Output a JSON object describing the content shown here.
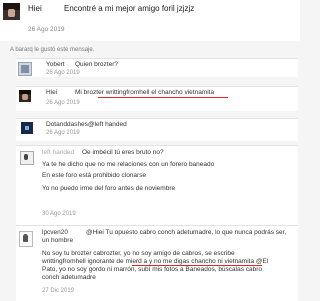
{
  "top_message": {
    "author": "Hiei",
    "text": "Encontré a mi mejor amigo foril jzjzjz",
    "date": "26 Ago 2019"
  },
  "reaction": {
    "text": "A bararq le gustó este mensaje."
  },
  "messages": [
    {
      "author": "Yobert",
      "text": "Quien brozter?",
      "date": "26 Ago 2019",
      "lines": []
    },
    {
      "author": "Hiei",
      "text": "Mi brozter writtingfromhell el chancho vietnamita",
      "date": "26 Ago 2019",
      "lines": []
    },
    {
      "author": "Dotanddashes",
      "text": "@left handed",
      "date": "26 Ago 2019",
      "lines": []
    },
    {
      "author": "left handed",
      "text": "Oe imbécil tú eres bruto no?",
      "date": "30 Ago 2019",
      "lines": [
        "Ya te he dicho que no me relaciones con un forero baneado",
        "En este foro está prohibido clonarse",
        "Yo no puedo irme del foro antes de noviembre"
      ]
    },
    {
      "author": "lpcven20",
      "text": "@Hiei Tu opuesto cabro conch adetumadre, lo que nunca podrás ser,",
      "date": "27 Dic 2019",
      "lines": [
        "un hombre",
        "No soy tu brozter cabrozter, yo no soy amigo de cabros, se escribe",
        "writtingfromhell ignorante de mierd a y no me digas chancho ni vietnamita @El",
        "Pato, yo no soy gordo ni marrón, subí mis fotos a Baneados, búscalas cabro",
        "conch adetumadre"
      ]
    }
  ]
}
